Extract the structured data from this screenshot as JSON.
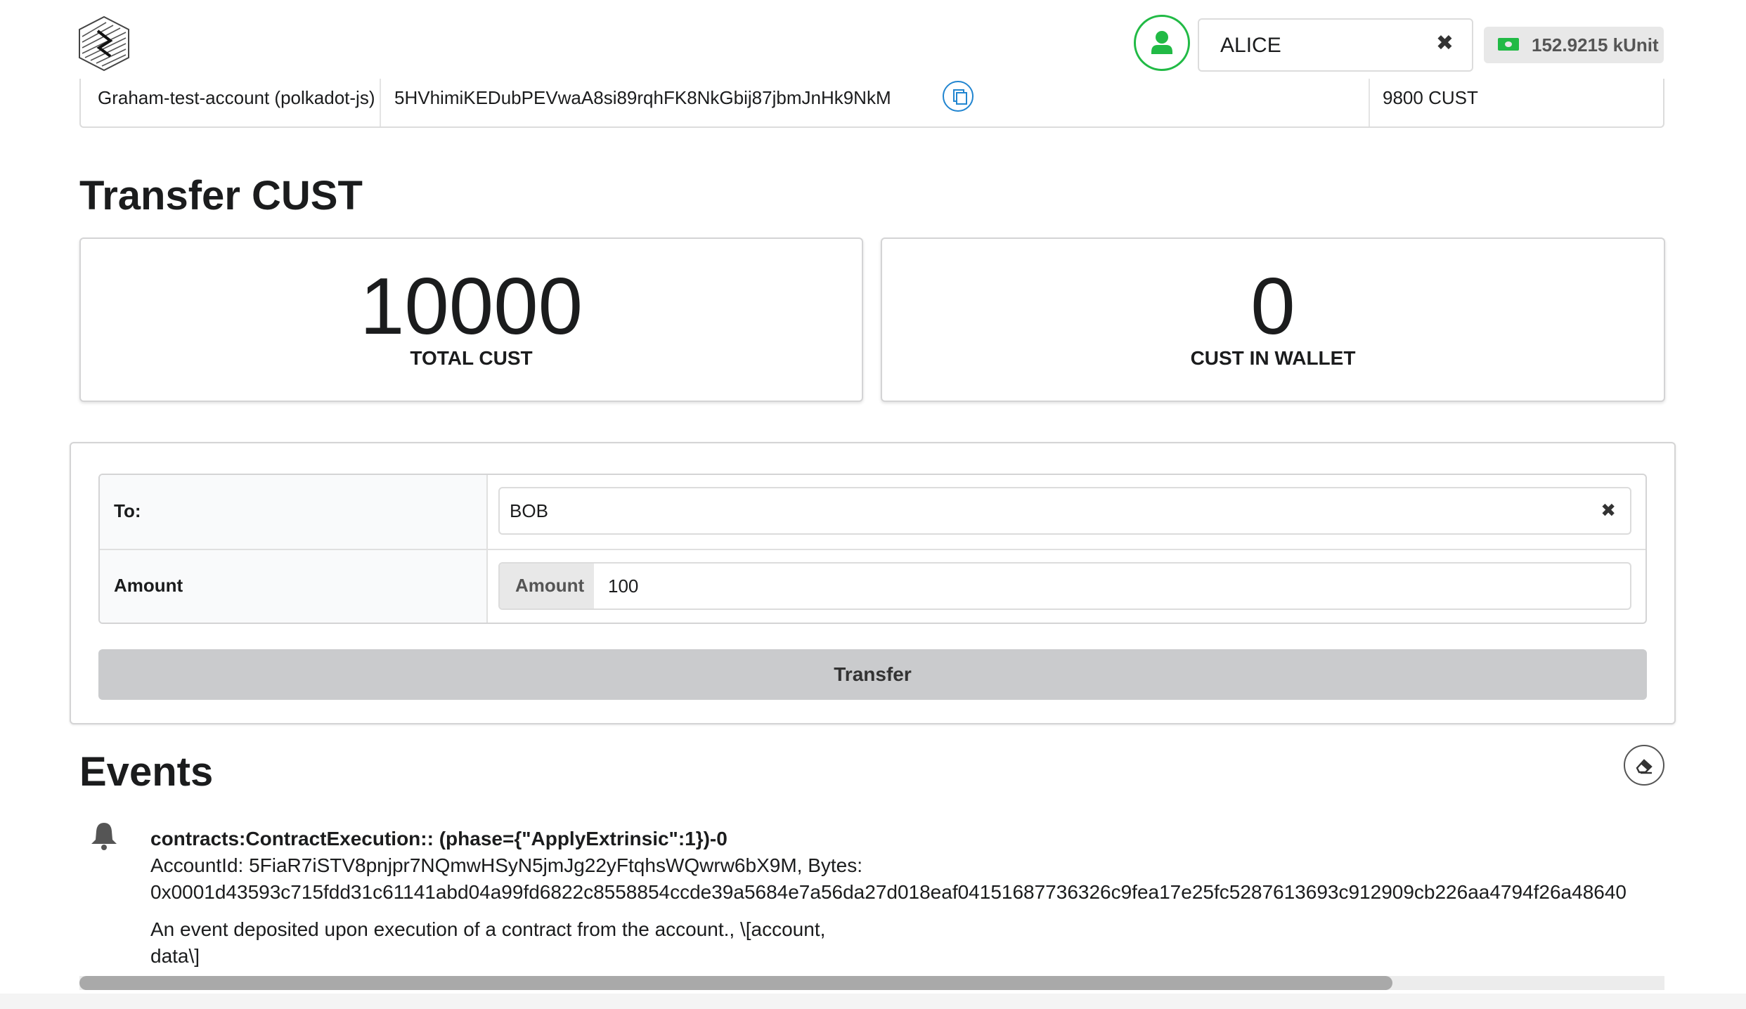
{
  "header": {
    "account": {
      "selected": "ALICE",
      "clear_icon": "✖"
    },
    "balance": "152.9215 kUnit",
    "icons": {
      "logo": "hex-logo-icon",
      "account": "user-icon",
      "balance": "money-bill-icon"
    },
    "colors": {
      "avatar_border": "#21ba45",
      "balance_icon": "#21ba45"
    }
  },
  "previous_row": {
    "name": "Graham-test-account (polkadot-js)",
    "address": "5HVhimiKEDubPEVwaA8si89rqhFK8NkGbij87jbmJnHk9NkM",
    "amount": "9800 CUST",
    "copy_icon": "copy-icon"
  },
  "transfer": {
    "title": "Transfer CUST",
    "stats": [
      {
        "value": "10000",
        "label": "TOTAL CUST"
      },
      {
        "value": "0",
        "label": "CUST IN WALLET"
      }
    ],
    "form": {
      "to_label": "To:",
      "to_value": "BOB",
      "amount_label": "Amount",
      "amount_addon": "Amount",
      "amount_value": "100",
      "button": "Transfer"
    }
  },
  "events": {
    "title": "Events",
    "clear_icon": "eraser-icon",
    "items": [
      {
        "icon": "bell-icon",
        "title": "contracts:ContractExecution:: (phase={\"ApplyExtrinsic\":1})-0",
        "line1": "AccountId: 5FiaR7iSTV8pnjpr7NQmwHSyN5jmJg22yFtqhsWQwrw6bX9M, Bytes:",
        "line2": "0x0001d43593c715fdd31c61141abd04a99fd6822c8558854ccde39a5684e7a56da27d018eaf04151687736326c9fea17e25fc5287613693c912909cb226aa4794f26a48640",
        "desc1": "An event deposited upon execution of a contract from the account., \\[account,",
        "desc2": "data\\]"
      }
    ]
  },
  "scrollbar": {
    "position": 0.83
  }
}
